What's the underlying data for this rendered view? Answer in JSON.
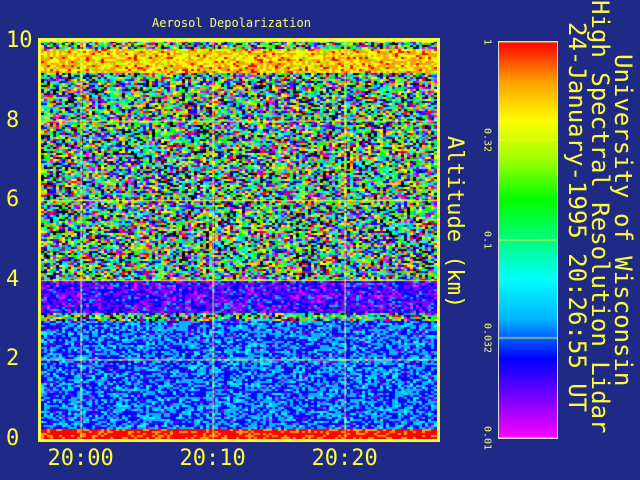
{
  "chart_data": {
    "type": "heatmap",
    "title": "Aerosol Depolarization",
    "ylabel": "Altitude (km)",
    "xlabel": "",
    "y_ticks": [
      "0",
      "2",
      "4",
      "6",
      "8",
      "10"
    ],
    "ylim": [
      0,
      10
    ],
    "x_ticks": [
      "20:00",
      "20:10",
      "20:20"
    ],
    "x_tick_minutes": [
      0,
      10,
      20
    ],
    "xlim_minutes": [
      -3,
      27
    ],
    "colorbar": {
      "scale": "log",
      "range": [
        0.01,
        1
      ],
      "ticks": [
        "1",
        "0.32",
        "0.1",
        "0.032",
        "0.01"
      ],
      "tick_values": [
        1,
        0.32,
        0.1,
        0.032,
        0.01
      ],
      "colors": [
        "#ff00ff",
        "#7a00ff",
        "#0000ff",
        "#00b4ff",
        "#00ffff",
        "#00ff80",
        "#00ff00",
        "#9aff00",
        "#ffff00",
        "#ffa000",
        "#ff0000"
      ]
    },
    "grid": true,
    "layers": [
      {
        "altitude_range_km": [
          0,
          0.3
        ],
        "depolarization": 1,
        "description_color": "red-orange"
      },
      {
        "altitude_range_km": [
          0.3,
          3.0
        ],
        "depolarization": 0.032,
        "description_color": "cyan-blue"
      },
      {
        "altitude_range_km": [
          3.2,
          4.0
        ],
        "depolarization": 0.02,
        "description_color": "cyan-purple"
      },
      {
        "altitude_range_km": [
          9.2,
          9.8
        ],
        "depolarization": 0.5,
        "description_color": "yellow"
      }
    ]
  },
  "instrument": {
    "line1": "University of Wisconsin",
    "line2": "High Spectral Resolution Lidar",
    "line3": "24-January-1995 20:26:55 UT"
  },
  "colors": {
    "background": "#1f2a86",
    "text": "#ffff3a",
    "frame": "#ffff3a"
  }
}
